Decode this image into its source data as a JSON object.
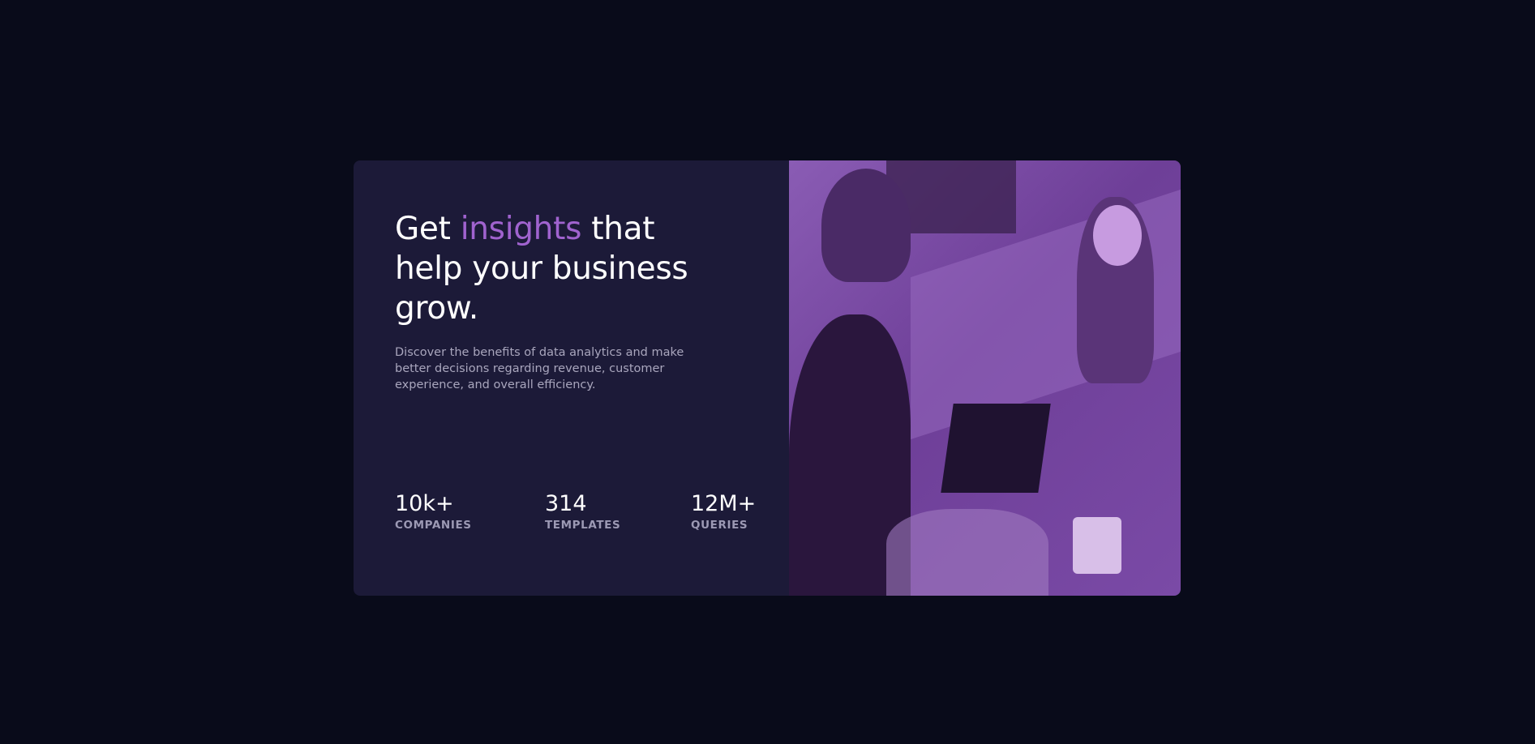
{
  "hero": {
    "title_pre": "Get ",
    "title_accent": "insights",
    "title_post": " that help your business grow.",
    "description": "Discover the benefits of data analytics and make better decisions regarding revenue, customer experience, and overall efficiency."
  },
  "stats": [
    {
      "value": "10k+",
      "label": "COMPANIES"
    },
    {
      "value": "314",
      "label": "TEMPLATES"
    },
    {
      "value": "12M+",
      "label": "QUERIES"
    }
  ],
  "colors": {
    "background": "#090b1a",
    "card": "#1c1a38",
    "accent": "#a063cf"
  }
}
